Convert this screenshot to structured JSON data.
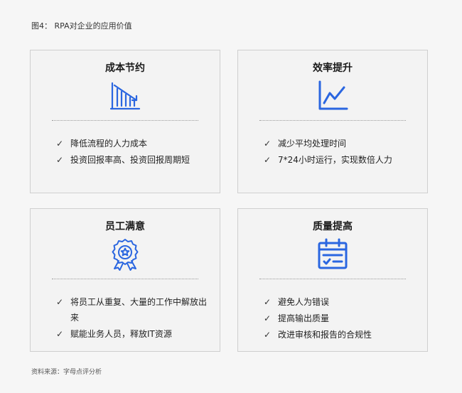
{
  "figure_title": "图4： RPA对企业的应用价值",
  "source": "资料来源：字母点评分析",
  "accent_color": "#2a66e0",
  "cards": [
    {
      "title": "成本节约",
      "icon": "bar-chart-down-icon",
      "items": [
        "降低流程的人力成本",
        "投资回报率高、投资回报周期短"
      ]
    },
    {
      "title": "效率提升",
      "icon": "line-chart-up-icon",
      "items": [
        "减少平均处理时间",
        "7*24小时运行，实现数倍人力"
      ]
    },
    {
      "title": "员工满意",
      "icon": "award-ribbon-icon",
      "items": [
        "将员工从重复、大量的工作中解放出来",
        "赋能业务人员，释放IT资源"
      ]
    },
    {
      "title": "质量提高",
      "icon": "calendar-check-icon",
      "items": [
        "避免人为错误",
        "提高输出质量",
        "改进审核和报告的合规性"
      ]
    }
  ],
  "check_glyph": "✓"
}
